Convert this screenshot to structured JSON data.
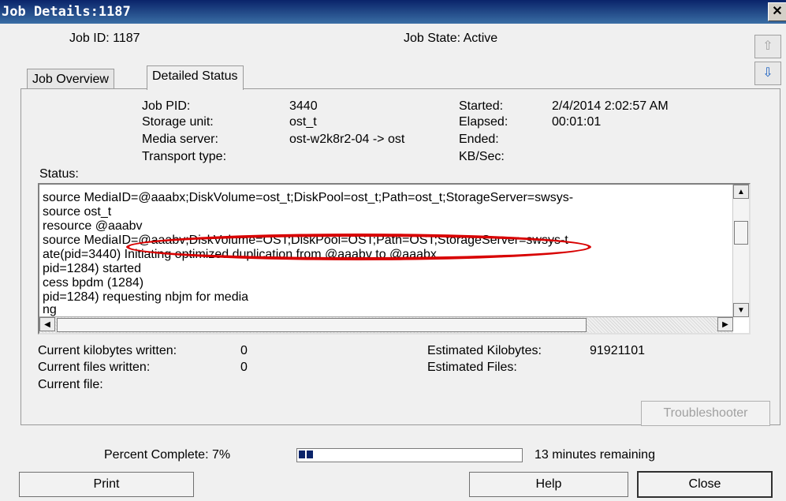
{
  "window": {
    "title": "Job Details:1187",
    "close_glyph": "✕"
  },
  "header": {
    "job_id": "Job ID: 1187",
    "job_state": "Job State: Active",
    "up_icon": "⇧",
    "down_icon": "⇩"
  },
  "tabs": [
    {
      "label": "Job Overview",
      "active": false
    },
    {
      "label": "Detailed Status",
      "active": true
    }
  ],
  "details": {
    "job_pid_label": "Job PID:",
    "job_pid_value": "3440",
    "storage_unit_label": "Storage unit:",
    "storage_unit_value": "ost_t",
    "media_server_label": "Media server:",
    "media_server_value": "ost-w2k8r2-04 -> ost",
    "transport_type_label": "Transport type:",
    "started_label": "Started:",
    "started_value": "2/4/2014 2:02:57 AM",
    "elapsed_label": "Elapsed:",
    "elapsed_value": "00:01:01",
    "ended_label": "Ended:",
    "kbsec_label": "KB/Sec:"
  },
  "status": {
    "label": "Status:",
    "lines": [
      "source MediaID=@aaabx;DiskVolume=ost_t;DiskPool=ost_t;Path=ost_t;StorageServer=swsys-",
      "source ost_t",
      " resource @aaabv",
      "source MediaID=@aaabv;DiskVolume=OST;DiskPool=OST;Path=OST;StorageServer=swsys-t",
      "ate(pid=3440) Initiating optimized duplication from @aaabv to @aaabx",
      "pid=1284) started",
      "cess bpdm (1284)",
      "pid=1284) requesting nbjm for media",
      "ng"
    ]
  },
  "progress_info": {
    "current_kb_label": "Current kilobytes written:",
    "current_kb_value": "0",
    "current_files_label": "Current files written:",
    "current_files_value": "0",
    "current_file_label": "Current file:",
    "est_kb_label": "Estimated Kilobytes:",
    "est_kb_value": "91921101",
    "est_files_label": "Estimated Files:"
  },
  "troubleshooter_label": "Troubleshooter",
  "percent": {
    "label": "Percent Complete: 7%",
    "value": 0.07,
    "remaining": "13 minutes remaining"
  },
  "buttons": {
    "print": "Print",
    "help": "Help",
    "close": "Close"
  },
  "colors": {
    "highlight_oval": "#d80000",
    "title_bar": "#0a246a"
  }
}
